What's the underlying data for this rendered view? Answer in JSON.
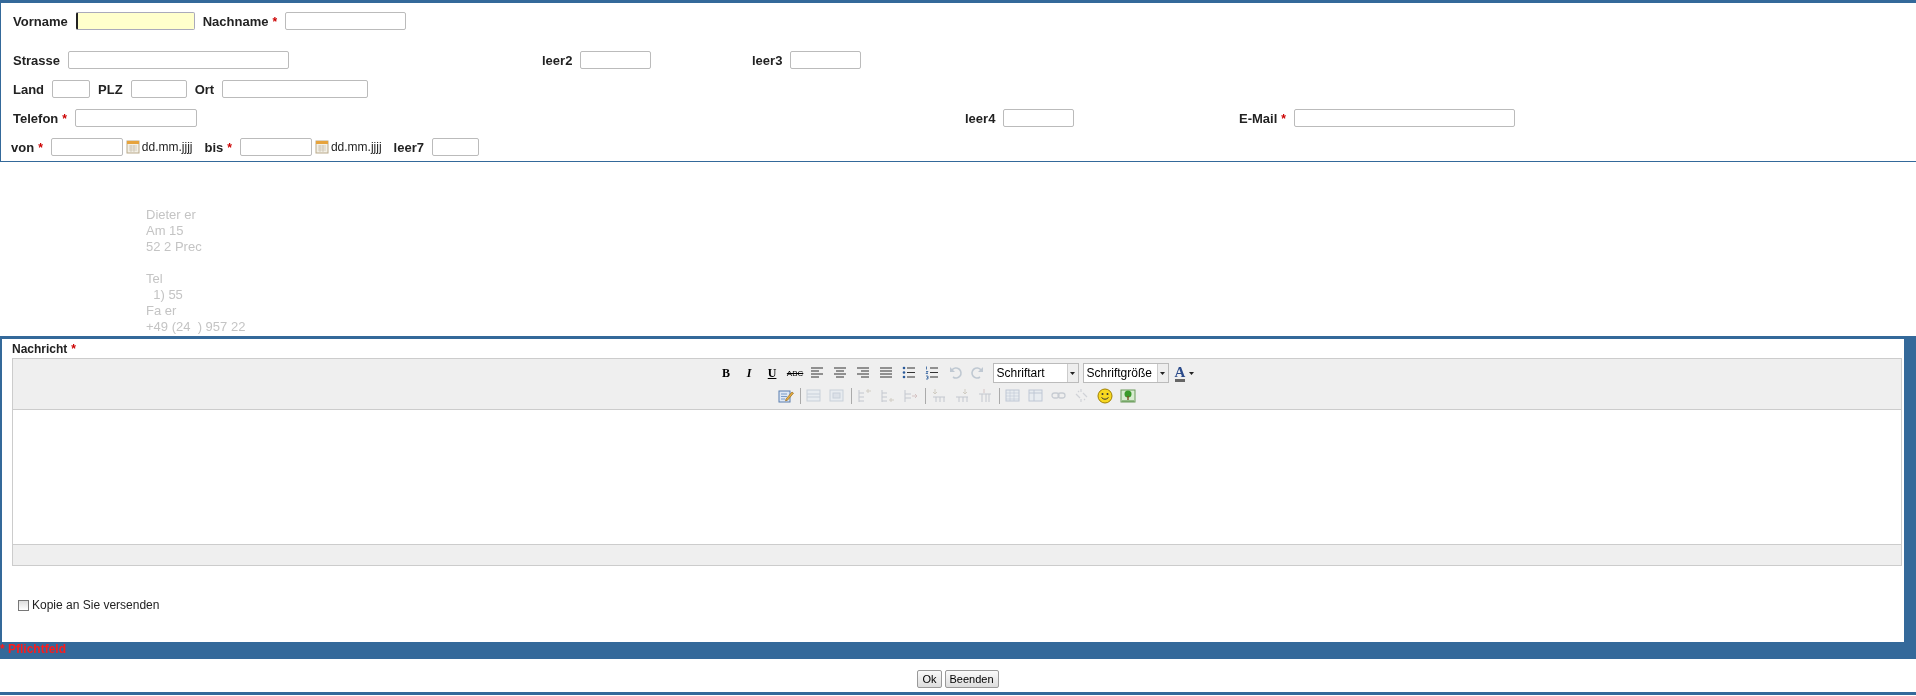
{
  "contact": {
    "rows": [
      {
        "fields": [
          {
            "label": "Vorname",
            "required": false,
            "kind": "text",
            "focused": true
          },
          {
            "label": "Nachname",
            "required": true,
            "kind": "text",
            "focused": false
          }
        ]
      },
      {
        "fields": [
          {
            "label": "Strasse",
            "required": false,
            "kind": "text",
            "focused": false
          },
          {
            "label": "leer2",
            "required": false,
            "kind": "text",
            "focused": false
          },
          {
            "label": "leer3",
            "required": false,
            "kind": "text",
            "focused": false
          }
        ]
      },
      {
        "fields": [
          {
            "label": "Land",
            "required": false,
            "kind": "text",
            "focused": false
          },
          {
            "label": "PLZ",
            "required": false,
            "kind": "text",
            "focused": false
          },
          {
            "label": "Ort",
            "required": false,
            "kind": "text",
            "focused": false
          }
        ]
      },
      {
        "fields": [
          {
            "label": "Telefon",
            "required": true,
            "kind": "text",
            "focused": false
          },
          {
            "label": "leer4",
            "required": false,
            "kind": "text",
            "focused": false
          },
          {
            "label": "E-Mail",
            "required": true,
            "kind": "text",
            "focused": false
          }
        ]
      },
      {
        "fields": [
          {
            "label": "von",
            "required": true,
            "kind": "date",
            "hint": "dd.mm.jjjj",
            "focused": false
          },
          {
            "label": "bis",
            "required": true,
            "kind": "date",
            "hint": "dd.mm.jjjj",
            "focused": false
          },
          {
            "label": "leer7",
            "required": false,
            "kind": "text",
            "focused": false
          }
        ]
      }
    ],
    "required_mark": "*"
  },
  "faded_text": {
    "lines": [
      "Dieter er",
      "Am 15",
      "52 2 Prec",
      "Tel",
      "  1) 55",
      "Fa er",
      "+49 (24  ) 957 22"
    ]
  },
  "message": {
    "label": "Nachricht",
    "required": true,
    "toolbar": [
      [
        {
          "kind": "glyph",
          "label": "B",
          "disabled": false
        },
        {
          "kind": "glyph",
          "label": "I",
          "disabled": false
        },
        {
          "kind": "glyph",
          "label": "U",
          "disabled": false
        },
        {
          "kind": "glyph",
          "label": "ABC",
          "disabled": false
        },
        {
          "kind": "icon",
          "disabled": false
        },
        {
          "kind": "icon",
          "disabled": false
        },
        {
          "kind": "icon",
          "disabled": false
        },
        {
          "kind": "icon",
          "disabled": false
        },
        {
          "kind": "icon",
          "disabled": false
        },
        {
          "kind": "icon",
          "disabled": false
        },
        {
          "kind": "icon",
          "disabled": true
        },
        {
          "kind": "icon",
          "disabled": true
        },
        {
          "kind": "select",
          "label": "Schriftart"
        },
        {
          "kind": "select",
          "label": "Schriftgröße"
        },
        {
          "kind": "color",
          "label": "A"
        }
      ],
      [
        {
          "kind": "icon",
          "disabled": false
        },
        {
          "kind": "separator"
        },
        {
          "kind": "icon",
          "disabled": true
        },
        {
          "kind": "icon",
          "disabled": true
        },
        {
          "kind": "separator"
        },
        {
          "kind": "icon",
          "disabled": true
        },
        {
          "kind": "icon",
          "disabled": true
        },
        {
          "kind": "icon",
          "disabled": true
        },
        {
          "kind": "separator"
        },
        {
          "kind": "icon",
          "disabled": true
        },
        {
          "kind": "icon",
          "disabled": true
        },
        {
          "kind": "icon",
          "disabled": true
        },
        {
          "kind": "separator"
        },
        {
          "kind": "icon",
          "disabled": true
        },
        {
          "kind": "icon",
          "disabled": true
        },
        {
          "kind": "icon",
          "disabled": true
        },
        {
          "kind": "icon",
          "disabled": true
        },
        {
          "kind": "icon",
          "disabled": false
        },
        {
          "kind": "icon",
          "disabled": false
        }
      ]
    ],
    "copy_checkbox": {
      "label": "Kopie an Sie versenden",
      "checked": false
    }
  },
  "legend": "* Pflichtfeld",
  "buttons": [
    "Ok",
    "Beenden"
  ]
}
